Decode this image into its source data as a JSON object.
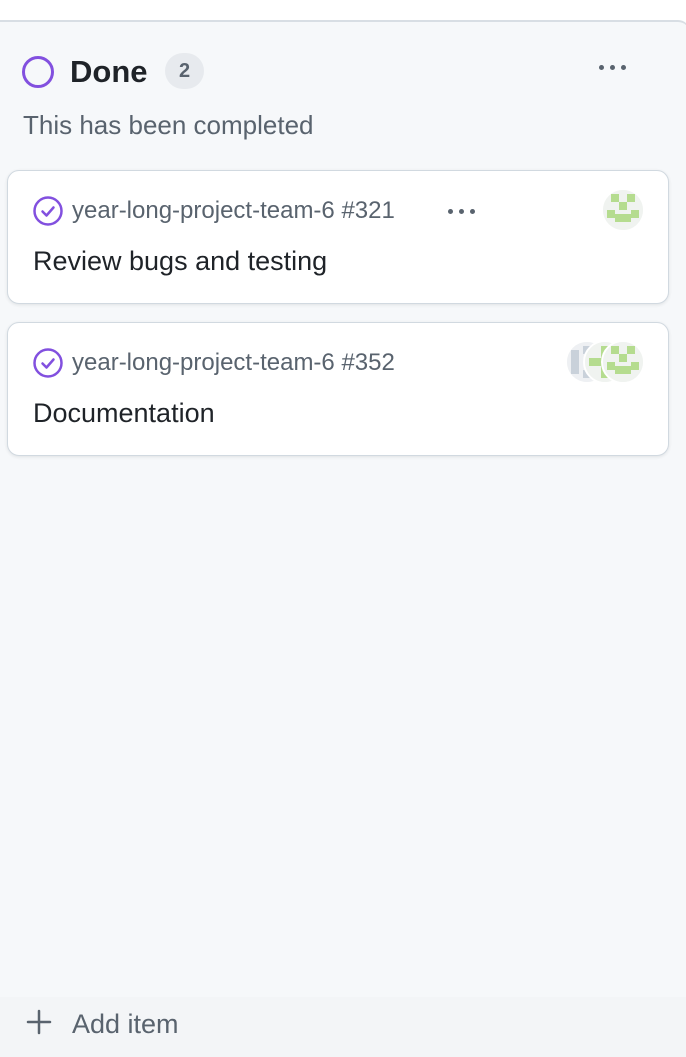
{
  "colors": {
    "column_background": "#f6f8fa",
    "status_done": "#8250df",
    "muted_text": "#59636e",
    "avatar_green": "#b5dc8f"
  },
  "column": {
    "title": "Done",
    "count": "2",
    "description": "This has been completed",
    "status_icon": "circle-icon",
    "menu_icon": "kebab-menu-icon"
  },
  "cards": [
    {
      "repo_ref": "year-long-project-team-6 #321",
      "title": "Review bugs and testing",
      "state_icon": "issue-closed-icon",
      "menu_icon": "kebab-menu-icon",
      "assignee_icons": [
        "avatar-icon"
      ]
    },
    {
      "repo_ref": "year-long-project-team-6 #352",
      "title": "Documentation",
      "state_icon": "issue-closed-icon",
      "assignee_icons": [
        "avatar-icon",
        "avatar-icon",
        "avatar-icon"
      ]
    }
  ],
  "footer": {
    "add_label": "Add item",
    "add_icon": "plus-icon"
  }
}
